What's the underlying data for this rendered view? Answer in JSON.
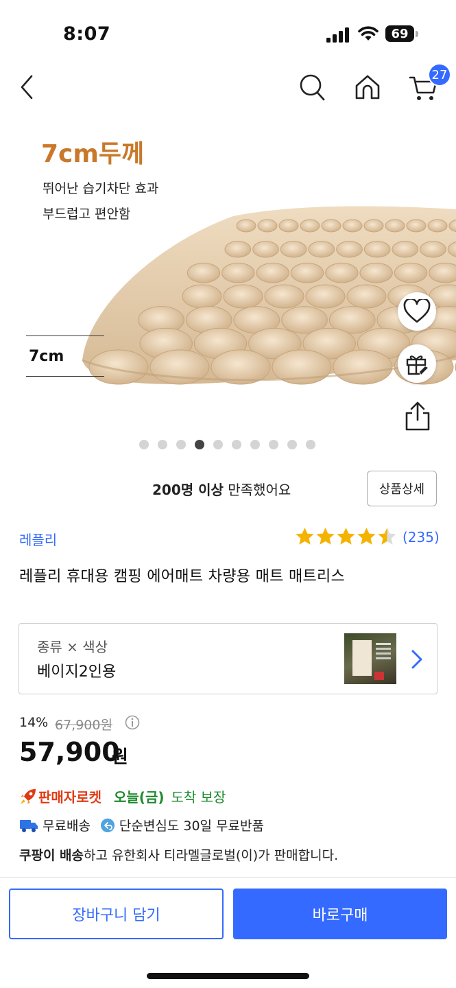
{
  "status_bar": {
    "time": "8:07",
    "battery": "69"
  },
  "nav": {
    "cart_count": "27"
  },
  "hero": {
    "headline": "7cm두께",
    "line1": "뛰어난 습기차단 효과",
    "line2": "부드럽고 편안함",
    "thickness_label": "7cm",
    "image_count": 10,
    "active_index": 3
  },
  "satisfaction": {
    "bold": "200명 이상",
    "rest": " 만족했어요",
    "detail_button": "상품상세"
  },
  "product": {
    "brand": "레플리",
    "rating": 4.5,
    "review_count": "(235)",
    "title": "레플리 휴대용 캠핑 에어매트 차량용 매트 매트리스"
  },
  "option": {
    "label": "종류 × 색상",
    "value": "베이지2인용"
  },
  "pricing": {
    "discount": "14%",
    "original": "67,900원",
    "price": "57,900",
    "unit": "원"
  },
  "delivery": {
    "seller_rocket": "판매자로켓",
    "arrive_day": "오늘(금)",
    "arrive_text": "도착 보장",
    "free_shipping": "무료배송",
    "free_return": "단순변심도 30일 무료반품",
    "seller_bold": "쿠팡이 배송",
    "seller_rest": "하고 유한회사 티라멜글로벌(이)가 판매합니다."
  },
  "bottom": {
    "cart_button": "장바구니 담기",
    "buy_button": "바로구매"
  },
  "colors": {
    "accent": "#346aff",
    "rocket": "#e03a12",
    "arrive": "#1e8a2e",
    "star": "#f5b301",
    "headline": "#c9782a"
  }
}
